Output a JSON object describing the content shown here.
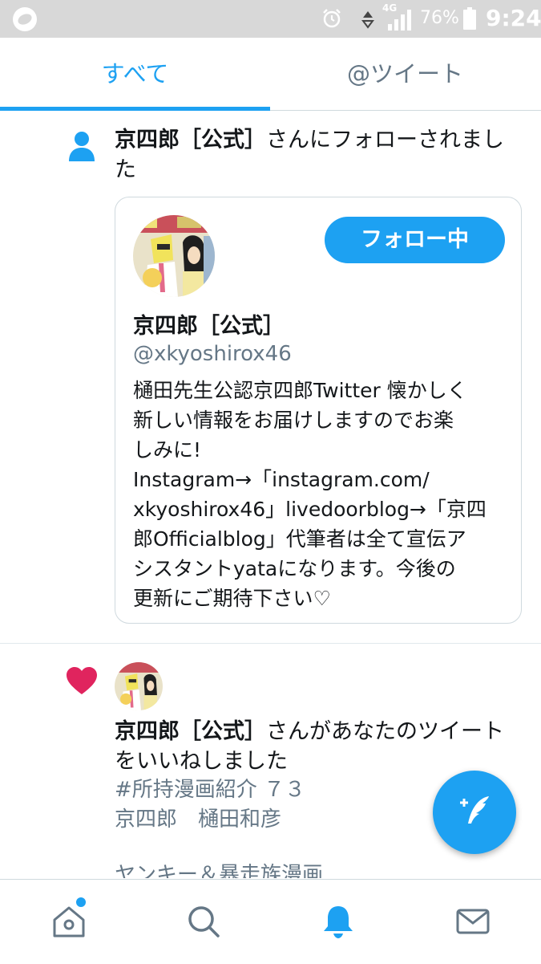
{
  "status_bar": {
    "network": "4G",
    "battery": "76%",
    "time": "9:24",
    "icons": [
      "app-logo-icon",
      "alarm-icon",
      "data-transfer-icon",
      "signal-icon",
      "battery-icon"
    ]
  },
  "tabs": [
    {
      "label": "すべて",
      "active": true
    },
    {
      "label": "@ツイート",
      "active": false
    }
  ],
  "notifications": [
    {
      "type": "follow",
      "icon": "person-icon",
      "actor": "京四郎［公式］",
      "line1_rest": "さんにフォローされまし",
      "line2": "た",
      "card": {
        "follow_button": "フォロー中",
        "name": "京四郎［公式］",
        "handle": "@xkyoshirox46",
        "bio_lines": [
          "樋田先生公認京四郎Twitter 懐かしく",
          "新しい情報をお届けしますのでお楽",
          "しみに!",
          "Instagram→「instagram.com/",
          "xkyoshirox46」livedoorblog→「京四",
          "郎Officialblog」代筆者は全て宣伝ア",
          "シスタントyataになります。今後の",
          "更新にご期待下さい♡"
        ]
      }
    },
    {
      "type": "like",
      "icon": "heart-icon",
      "actor": "京四郎［公式］",
      "line1_rest": "さんがあなたのツイート",
      "line2": "をいいねしました",
      "tweet_lines": [
        "#所持漫画紹介 ７３",
        "京四郎　樋田和彦",
        "ヤンキー＆暴走族漫画"
      ]
    }
  ],
  "colors": {
    "accent": "#1da1f2",
    "like": "#e0245e",
    "secondary_text": "#657786",
    "status_bar": "#d8d8d8"
  },
  "bottom_nav": [
    "home-icon",
    "search-icon",
    "notifications-bell-icon",
    "messages-envelope-icon"
  ]
}
